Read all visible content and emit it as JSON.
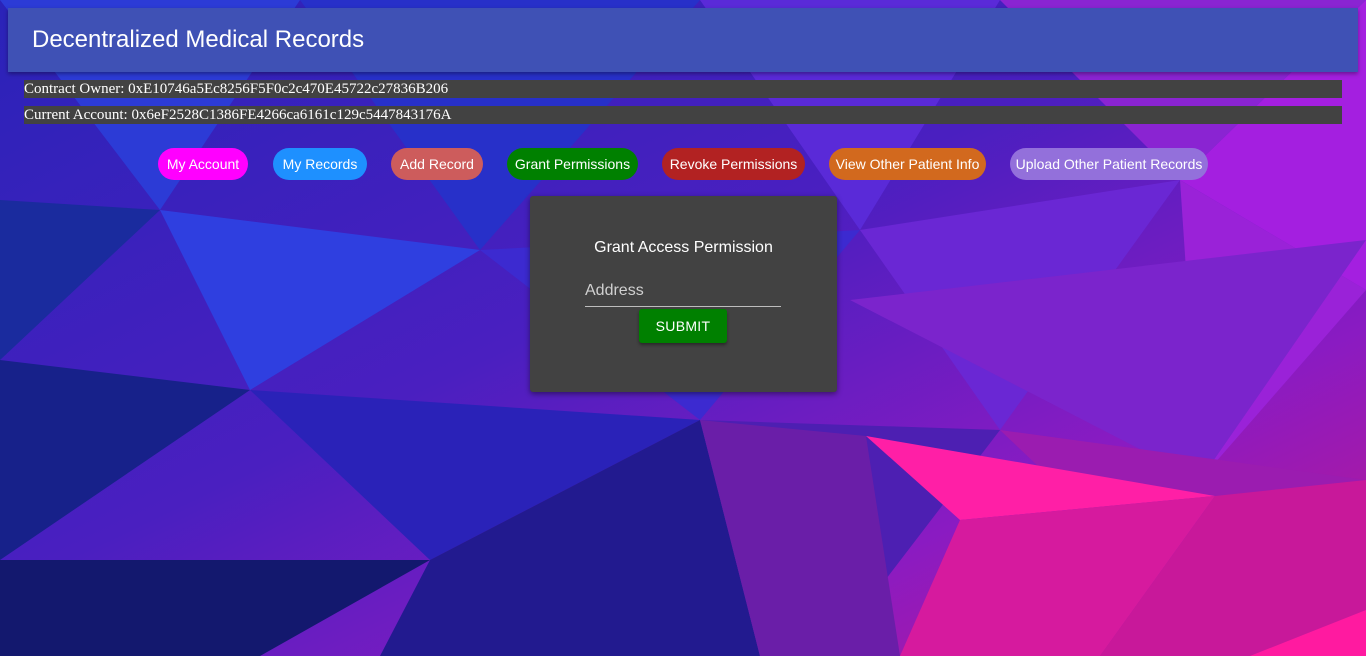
{
  "app": {
    "title": "Decentralized Medical Records"
  },
  "accounts": {
    "contract_owner": "Contract Owner: 0xE10746a5Ec8256F5F0c2c470E45722c27836B206",
    "current_account": "Current Account: 0x6eF2528C1386FE4266ca6161c129c5447843176A"
  },
  "nav": {
    "my_account": "My Account",
    "my_records": "My Records",
    "add_record": "Add Record",
    "grant_permissions": "Grant Permissions",
    "revoke_permissions": "Revoke Permissions",
    "view_other_patient_info": "View Other Patient Info",
    "upload_other_patient_records": "Upload Other Patient Records"
  },
  "form": {
    "title": "Grant Access Permission",
    "address_placeholder": "Address",
    "address_value": "",
    "submit_label": "SUBMIT"
  },
  "colors": {
    "appbar": "#3f51b5",
    "panel": "#424242",
    "my_account": "#ff00ff",
    "my_records": "#1e90ff",
    "add_record": "#cd5c5c",
    "grant_permissions": "#008000",
    "revoke_permissions": "#b22222",
    "view_other_patient_info": "#d2691e",
    "upload_other_patient_records": "#9370db"
  }
}
